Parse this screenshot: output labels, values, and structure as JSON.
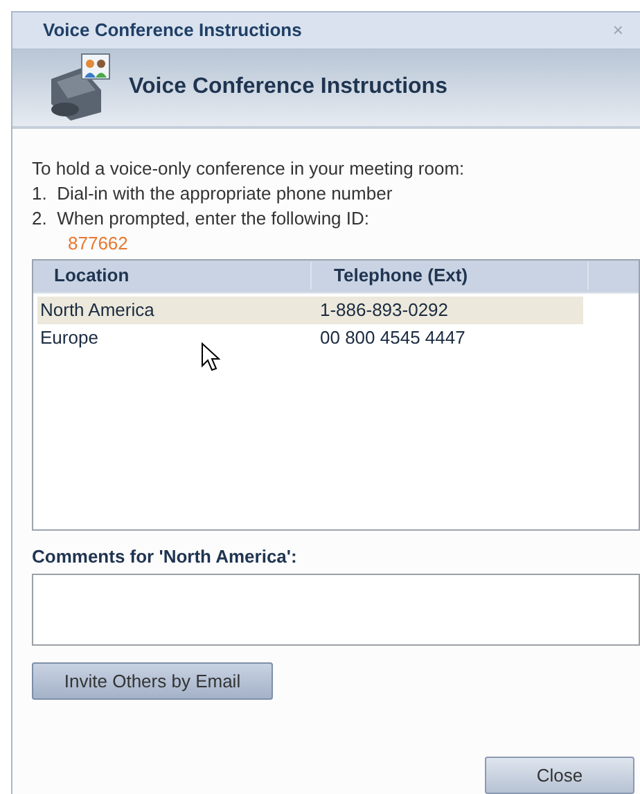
{
  "window": {
    "title": "Voice Conference Instructions",
    "close": "×"
  },
  "header": {
    "title": "Voice Conference Instructions"
  },
  "instructions": {
    "intro": "To hold a voice-only conference in your meeting room:",
    "steps": [
      "1.  Dial-in with the appropriate phone number",
      "2.  When prompted, enter the following ID:"
    ],
    "conference_id": "877662"
  },
  "table": {
    "columns": [
      "Location",
      "Telephone (Ext)"
    ],
    "rows": [
      {
        "location": "North America",
        "telephone": "1-886-893-0292",
        "selected": true
      },
      {
        "location": "Europe",
        "telephone": "00 800 4545 4447",
        "selected": false
      }
    ]
  },
  "comments": {
    "label": "Comments for 'North America':"
  },
  "buttons": {
    "invite": "Invite Others by Email",
    "close": "Close"
  }
}
